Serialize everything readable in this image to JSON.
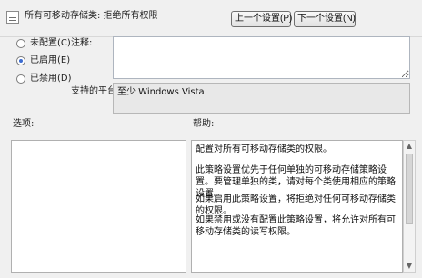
{
  "header": {
    "title": "所有可移动存储类: 拒绝所有权限",
    "prev_button": "上一个设置(P)",
    "next_button": "下一个设置(N)"
  },
  "options": {
    "not_configured": "未配置(C)",
    "enabled": "已启用(E)",
    "disabled": "已禁用(D)"
  },
  "fields": {
    "comment_label": "注释:",
    "support_label": "支持的平台:",
    "support_value": "至少 Windows Vista"
  },
  "sections": {
    "options_label": "选项:",
    "help_label": "帮助:"
  },
  "help": {
    "paragraphs": [
      "配置对所有可移动存储类的权限。",
      "此策略设置优先于任何单独的可移动存储策略设置。要管理单独的类，请对每个类使用相应的策略设置。",
      "如果启用此策略设置，将拒绝对任何可移动存储类的权限。",
      "如果禁用或没有配置此策略设置，将允许对所有可移动存储类的读写权限。"
    ]
  }
}
